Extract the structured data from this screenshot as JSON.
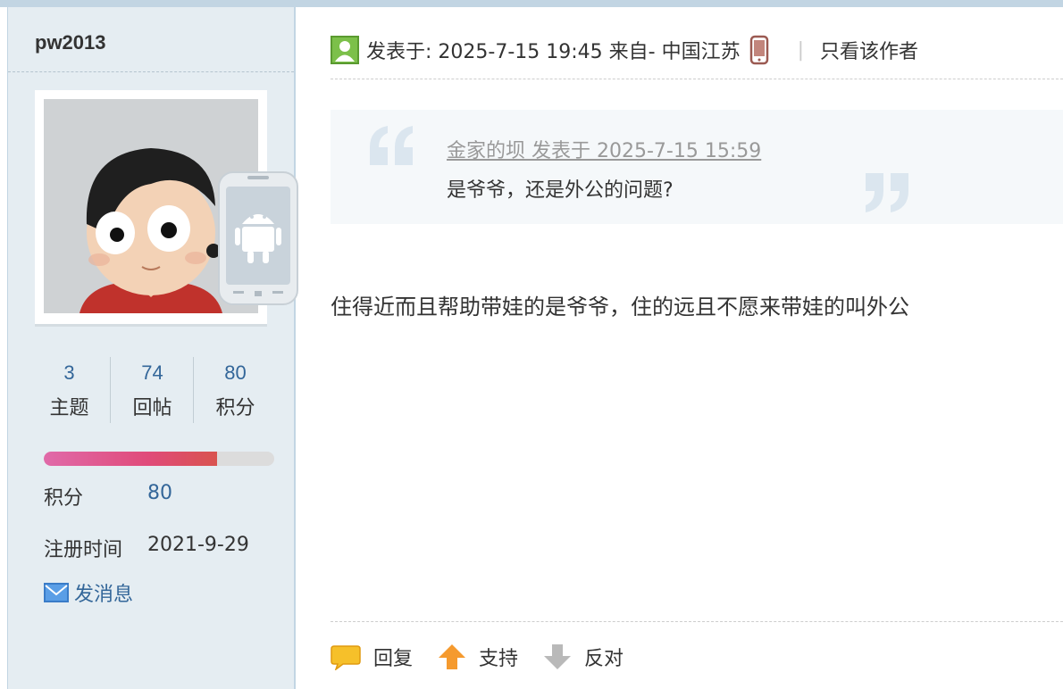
{
  "sidebar": {
    "username": "pw2013",
    "stats": [
      {
        "value": "3",
        "label": "主题"
      },
      {
        "value": "74",
        "label": "回帖"
      },
      {
        "value": "80",
        "label": "积分"
      }
    ],
    "credit_progress": 0.75,
    "credit_label": "积分",
    "credit_value": "80",
    "register_label": "注册时间",
    "register_value": "2021-9-29",
    "message_label": "发消息"
  },
  "post": {
    "posted_text": "发表于: 2025-7-15 19:45 来自- 中国江苏",
    "only_author": "只看该作者",
    "quote_author": "金家的坝 发表于 2025-7-15 15:59",
    "quote_text": "是爷爷，还是外公的问题?",
    "content": "住得近而且帮助带娃的是爷爷，住的远且不愿来带娃的叫外公"
  },
  "actions": {
    "reply": "回复",
    "support": "支持",
    "oppose": "反对"
  },
  "colors": {
    "sidebar_bg": "#e5edf2",
    "link": "#336699",
    "quote_bg": "#f5f8fa",
    "progress_fill": "#e04b7a"
  }
}
